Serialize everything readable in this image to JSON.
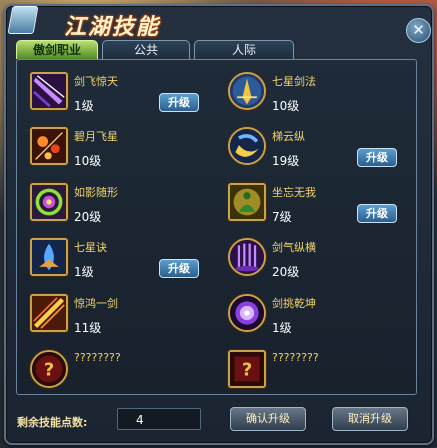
{
  "window": {
    "title": "江湖技能",
    "close_label": "✕"
  },
  "tabs": [
    {
      "label": "傲剑职业",
      "active": true
    },
    {
      "label": "公共",
      "active": false
    },
    {
      "label": "人际",
      "active": false
    }
  ],
  "skills": [
    {
      "name": "剑飞惊天",
      "level": "1级",
      "upgrade_label": "升级",
      "icon": "purple-sword-slash-icon"
    },
    {
      "name": "七星剑法",
      "level": "10级",
      "upgrade_label": "",
      "icon": "golden-swordsman-icon"
    },
    {
      "name": "碧月飞星",
      "level": "10级",
      "upgrade_label": "",
      "icon": "flying-stars-icon"
    },
    {
      "name": "梯云纵",
      "level": "19级",
      "upgrade_label": "升级",
      "icon": "blue-crescent-icon"
    },
    {
      "name": "如影随形",
      "level": "20级",
      "upgrade_label": "",
      "icon": "green-spiral-icon"
    },
    {
      "name": "坐忘无我",
      "level": "7级",
      "upgrade_label": "升级",
      "icon": "meditation-icon"
    },
    {
      "name": "七星诀",
      "level": "1级",
      "upgrade_label": "升级",
      "icon": "blue-flame-icon"
    },
    {
      "name": "剑气纵横",
      "level": "20级",
      "upgrade_label": "",
      "icon": "purple-sword-rain-icon"
    },
    {
      "name": "惊鸿一剑",
      "level": "11级",
      "upgrade_label": "",
      "icon": "fire-sword-icon"
    },
    {
      "name": "剑挑乾坤",
      "level": "1级",
      "upgrade_label": "",
      "icon": "purple-orb-icon"
    },
    {
      "name": "????????",
      "level": "",
      "upgrade_label": "",
      "icon": "unknown-round-icon"
    },
    {
      "name": "????????",
      "level": "",
      "upgrade_label": "",
      "icon": "unknown-square-icon"
    }
  ],
  "footer": {
    "points_label": "剩余技能点数:",
    "points_value": "4",
    "confirm_label": "确认升级",
    "cancel_label": "取消升级"
  },
  "colors": {
    "skill_name": "#f3d36a",
    "tab_active": "#8cc84b",
    "upgrade_button": "#3f7fb5"
  }
}
